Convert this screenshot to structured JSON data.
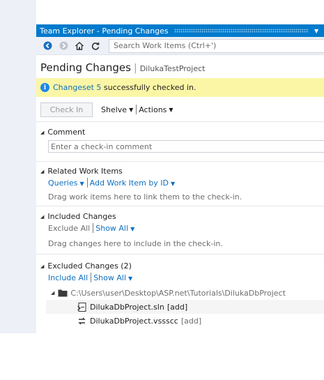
{
  "window": {
    "title": "Team Explorer - Pending Changes"
  },
  "toolbar": {
    "search_placeholder": "Search Work Items (Ctrl+')"
  },
  "header": {
    "title": "Pending Changes",
    "project": "DilukaTestProject"
  },
  "notice": {
    "link": "Changeset 5",
    "text": " successfully checked in."
  },
  "actions": {
    "check_in": "Check In",
    "shelve": "Shelve",
    "actions": "Actions"
  },
  "comment": {
    "title": "Comment",
    "placeholder": "Enter a check-in comment"
  },
  "related": {
    "title": "Related Work Items",
    "queries": "Queries",
    "add_by_id": "Add Work Item by ID",
    "hint": "Drag work items here to link them to the check-in."
  },
  "included": {
    "title": "Included Changes",
    "exclude_all": "Exclude All",
    "show_all": "Show All",
    "hint": "Drag changes here to include in the check-in."
  },
  "excluded": {
    "title": "Excluded Changes (2)",
    "include_all": "Include All",
    "show_all": "Show All",
    "folder": "C:\\Users\\user\\Desktop\\ASP.net\\Tutorials\\DilukaDbProject",
    "files": [
      {
        "name": "DilukaDbProject.sln",
        "status": "[add]"
      },
      {
        "name": "DilukaDbProject.vssscc",
        "status": "[add]"
      }
    ]
  },
  "colors": {
    "accent": "#007acc",
    "link": "#0e70c0",
    "notice_bg": "#fbf6a6"
  }
}
